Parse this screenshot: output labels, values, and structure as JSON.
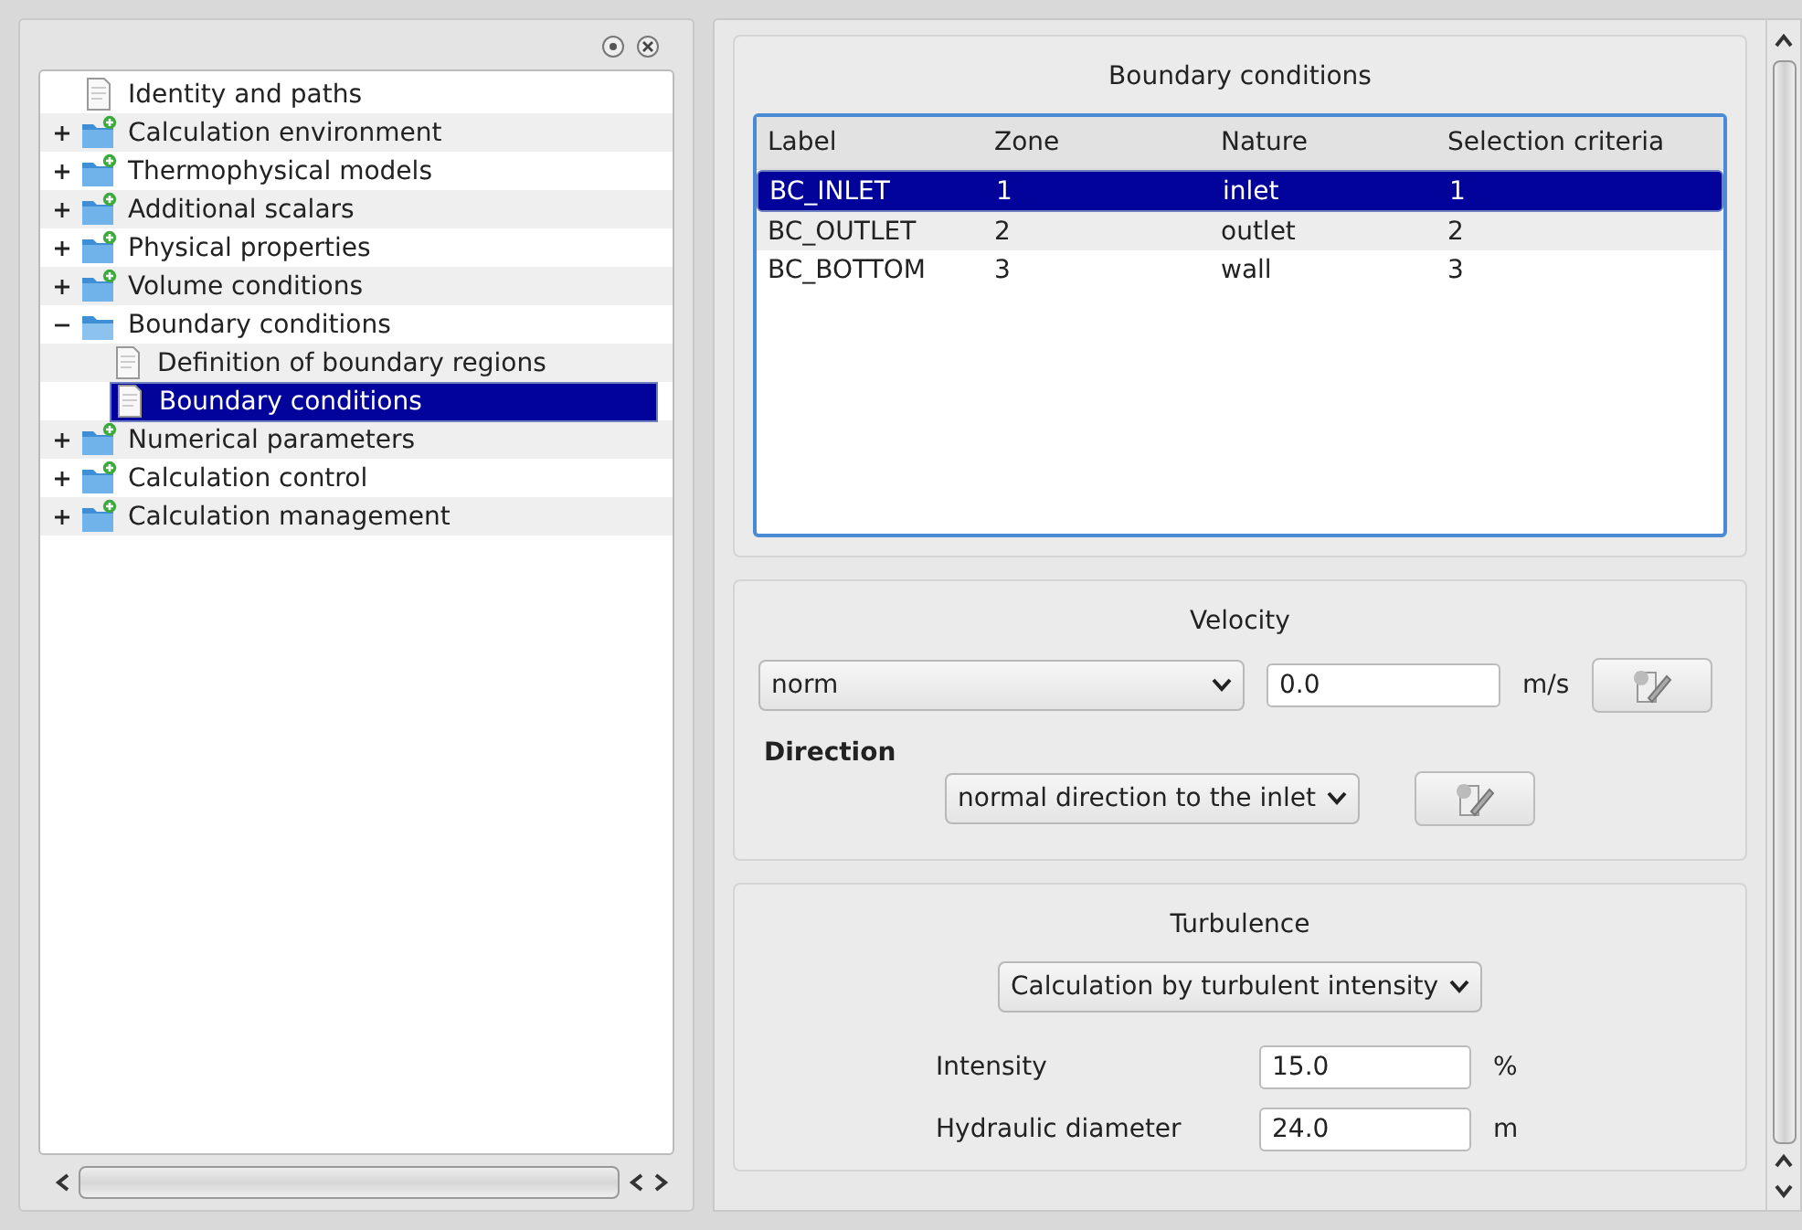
{
  "tree": [
    {
      "label": "Identity and paths",
      "kind": "page",
      "selected": false
    },
    {
      "label": "Calculation environment",
      "kind": "folder",
      "expanded": false,
      "selected": false
    },
    {
      "label": "Thermophysical models",
      "kind": "folder",
      "expanded": false,
      "selected": false
    },
    {
      "label": "Additional scalars",
      "kind": "folder",
      "expanded": false,
      "selected": false
    },
    {
      "label": "Physical properties",
      "kind": "folder",
      "expanded": false,
      "selected": false
    },
    {
      "label": "Volume conditions",
      "kind": "folder",
      "expanded": false,
      "selected": false
    },
    {
      "label": "Boundary conditions",
      "kind": "folder",
      "expanded": true,
      "selected": false,
      "children": [
        {
          "label": "Definition of boundary regions",
          "kind": "page",
          "selected": false
        },
        {
          "label": "Boundary conditions",
          "kind": "page",
          "selected": true
        }
      ]
    },
    {
      "label": "Numerical parameters",
      "kind": "folder",
      "expanded": false,
      "selected": false
    },
    {
      "label": "Calculation control",
      "kind": "folder",
      "expanded": false,
      "selected": false
    },
    {
      "label": "Calculation management",
      "kind": "folder",
      "expanded": false,
      "selected": false
    }
  ],
  "boundary": {
    "title": "Boundary conditions",
    "columns": [
      "Label",
      "Zone",
      "Nature",
      "Selection criteria"
    ],
    "rows": [
      {
        "cells": [
          "BC_INLET",
          "1",
          "inlet",
          "1"
        ],
        "selected": true
      },
      {
        "cells": [
          "BC_OUTLET",
          "2",
          "outlet",
          "2"
        ],
        "selected": false
      },
      {
        "cells": [
          "BC_BOTTOM",
          "3",
          "wall",
          "3"
        ],
        "selected": false
      }
    ]
  },
  "velocity": {
    "title": "Velocity",
    "mode": "norm",
    "value": "0.0",
    "unit": "m/s",
    "direction_label": "Direction",
    "direction": "normal direction to the inlet"
  },
  "turbulence": {
    "title": "Turbulence",
    "method": "Calculation by turbulent intensity",
    "fields": [
      {
        "label": "Intensity",
        "value": "15.0",
        "unit": "%"
      },
      {
        "label": "Hydraulic diameter",
        "value": "24.0",
        "unit": "m"
      }
    ]
  }
}
